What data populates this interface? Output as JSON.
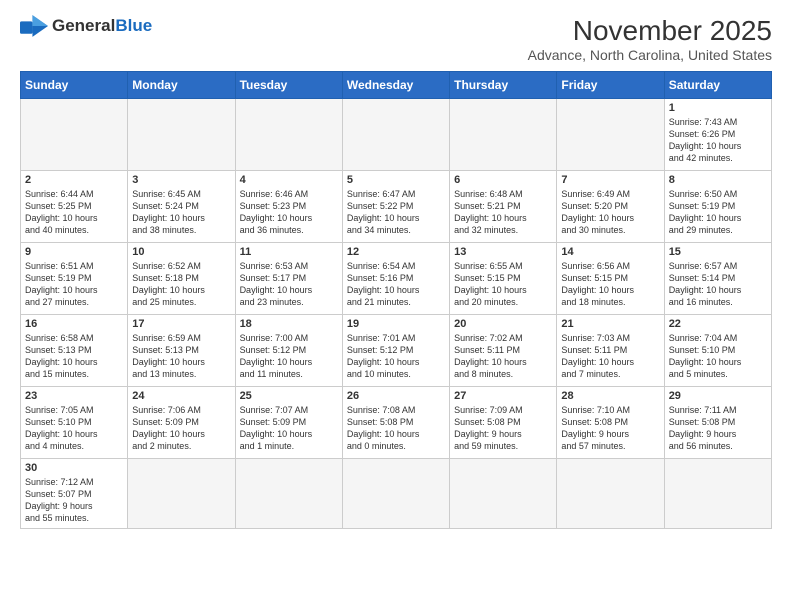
{
  "logo": {
    "text_general": "General",
    "text_blue": "Blue"
  },
  "header": {
    "month_title": "November 2025",
    "subtitle": "Advance, North Carolina, United States"
  },
  "weekdays": [
    "Sunday",
    "Monday",
    "Tuesday",
    "Wednesday",
    "Thursday",
    "Friday",
    "Saturday"
  ],
  "weeks": [
    [
      {
        "day": "",
        "info": ""
      },
      {
        "day": "",
        "info": ""
      },
      {
        "day": "",
        "info": ""
      },
      {
        "day": "",
        "info": ""
      },
      {
        "day": "",
        "info": ""
      },
      {
        "day": "",
        "info": ""
      },
      {
        "day": "1",
        "info": "Sunrise: 7:43 AM\nSunset: 6:26 PM\nDaylight: 10 hours\nand 42 minutes."
      }
    ],
    [
      {
        "day": "2",
        "info": "Sunrise: 6:44 AM\nSunset: 5:25 PM\nDaylight: 10 hours\nand 40 minutes."
      },
      {
        "day": "3",
        "info": "Sunrise: 6:45 AM\nSunset: 5:24 PM\nDaylight: 10 hours\nand 38 minutes."
      },
      {
        "day": "4",
        "info": "Sunrise: 6:46 AM\nSunset: 5:23 PM\nDaylight: 10 hours\nand 36 minutes."
      },
      {
        "day": "5",
        "info": "Sunrise: 6:47 AM\nSunset: 5:22 PM\nDaylight: 10 hours\nand 34 minutes."
      },
      {
        "day": "6",
        "info": "Sunrise: 6:48 AM\nSunset: 5:21 PM\nDaylight: 10 hours\nand 32 minutes."
      },
      {
        "day": "7",
        "info": "Sunrise: 6:49 AM\nSunset: 5:20 PM\nDaylight: 10 hours\nand 30 minutes."
      },
      {
        "day": "8",
        "info": "Sunrise: 6:50 AM\nSunset: 5:19 PM\nDaylight: 10 hours\nand 29 minutes."
      }
    ],
    [
      {
        "day": "9",
        "info": "Sunrise: 6:51 AM\nSunset: 5:19 PM\nDaylight: 10 hours\nand 27 minutes."
      },
      {
        "day": "10",
        "info": "Sunrise: 6:52 AM\nSunset: 5:18 PM\nDaylight: 10 hours\nand 25 minutes."
      },
      {
        "day": "11",
        "info": "Sunrise: 6:53 AM\nSunset: 5:17 PM\nDaylight: 10 hours\nand 23 minutes."
      },
      {
        "day": "12",
        "info": "Sunrise: 6:54 AM\nSunset: 5:16 PM\nDaylight: 10 hours\nand 21 minutes."
      },
      {
        "day": "13",
        "info": "Sunrise: 6:55 AM\nSunset: 5:15 PM\nDaylight: 10 hours\nand 20 minutes."
      },
      {
        "day": "14",
        "info": "Sunrise: 6:56 AM\nSunset: 5:15 PM\nDaylight: 10 hours\nand 18 minutes."
      },
      {
        "day": "15",
        "info": "Sunrise: 6:57 AM\nSunset: 5:14 PM\nDaylight: 10 hours\nand 16 minutes."
      }
    ],
    [
      {
        "day": "16",
        "info": "Sunrise: 6:58 AM\nSunset: 5:13 PM\nDaylight: 10 hours\nand 15 minutes."
      },
      {
        "day": "17",
        "info": "Sunrise: 6:59 AM\nSunset: 5:13 PM\nDaylight: 10 hours\nand 13 minutes."
      },
      {
        "day": "18",
        "info": "Sunrise: 7:00 AM\nSunset: 5:12 PM\nDaylight: 10 hours\nand 11 minutes."
      },
      {
        "day": "19",
        "info": "Sunrise: 7:01 AM\nSunset: 5:12 PM\nDaylight: 10 hours\nand 10 minutes."
      },
      {
        "day": "20",
        "info": "Sunrise: 7:02 AM\nSunset: 5:11 PM\nDaylight: 10 hours\nand 8 minutes."
      },
      {
        "day": "21",
        "info": "Sunrise: 7:03 AM\nSunset: 5:11 PM\nDaylight: 10 hours\nand 7 minutes."
      },
      {
        "day": "22",
        "info": "Sunrise: 7:04 AM\nSunset: 5:10 PM\nDaylight: 10 hours\nand 5 minutes."
      }
    ],
    [
      {
        "day": "23",
        "info": "Sunrise: 7:05 AM\nSunset: 5:10 PM\nDaylight: 10 hours\nand 4 minutes."
      },
      {
        "day": "24",
        "info": "Sunrise: 7:06 AM\nSunset: 5:09 PM\nDaylight: 10 hours\nand 2 minutes."
      },
      {
        "day": "25",
        "info": "Sunrise: 7:07 AM\nSunset: 5:09 PM\nDaylight: 10 hours\nand 1 minute."
      },
      {
        "day": "26",
        "info": "Sunrise: 7:08 AM\nSunset: 5:08 PM\nDaylight: 10 hours\nand 0 minutes."
      },
      {
        "day": "27",
        "info": "Sunrise: 7:09 AM\nSunset: 5:08 PM\nDaylight: 9 hours\nand 59 minutes."
      },
      {
        "day": "28",
        "info": "Sunrise: 7:10 AM\nSunset: 5:08 PM\nDaylight: 9 hours\nand 57 minutes."
      },
      {
        "day": "29",
        "info": "Sunrise: 7:11 AM\nSunset: 5:08 PM\nDaylight: 9 hours\nand 56 minutes."
      }
    ],
    [
      {
        "day": "30",
        "info": "Sunrise: 7:12 AM\nSunset: 5:07 PM\nDaylight: 9 hours\nand 55 minutes."
      },
      {
        "day": "",
        "info": ""
      },
      {
        "day": "",
        "info": ""
      },
      {
        "day": "",
        "info": ""
      },
      {
        "day": "",
        "info": ""
      },
      {
        "day": "",
        "info": ""
      },
      {
        "day": "",
        "info": ""
      }
    ]
  ]
}
